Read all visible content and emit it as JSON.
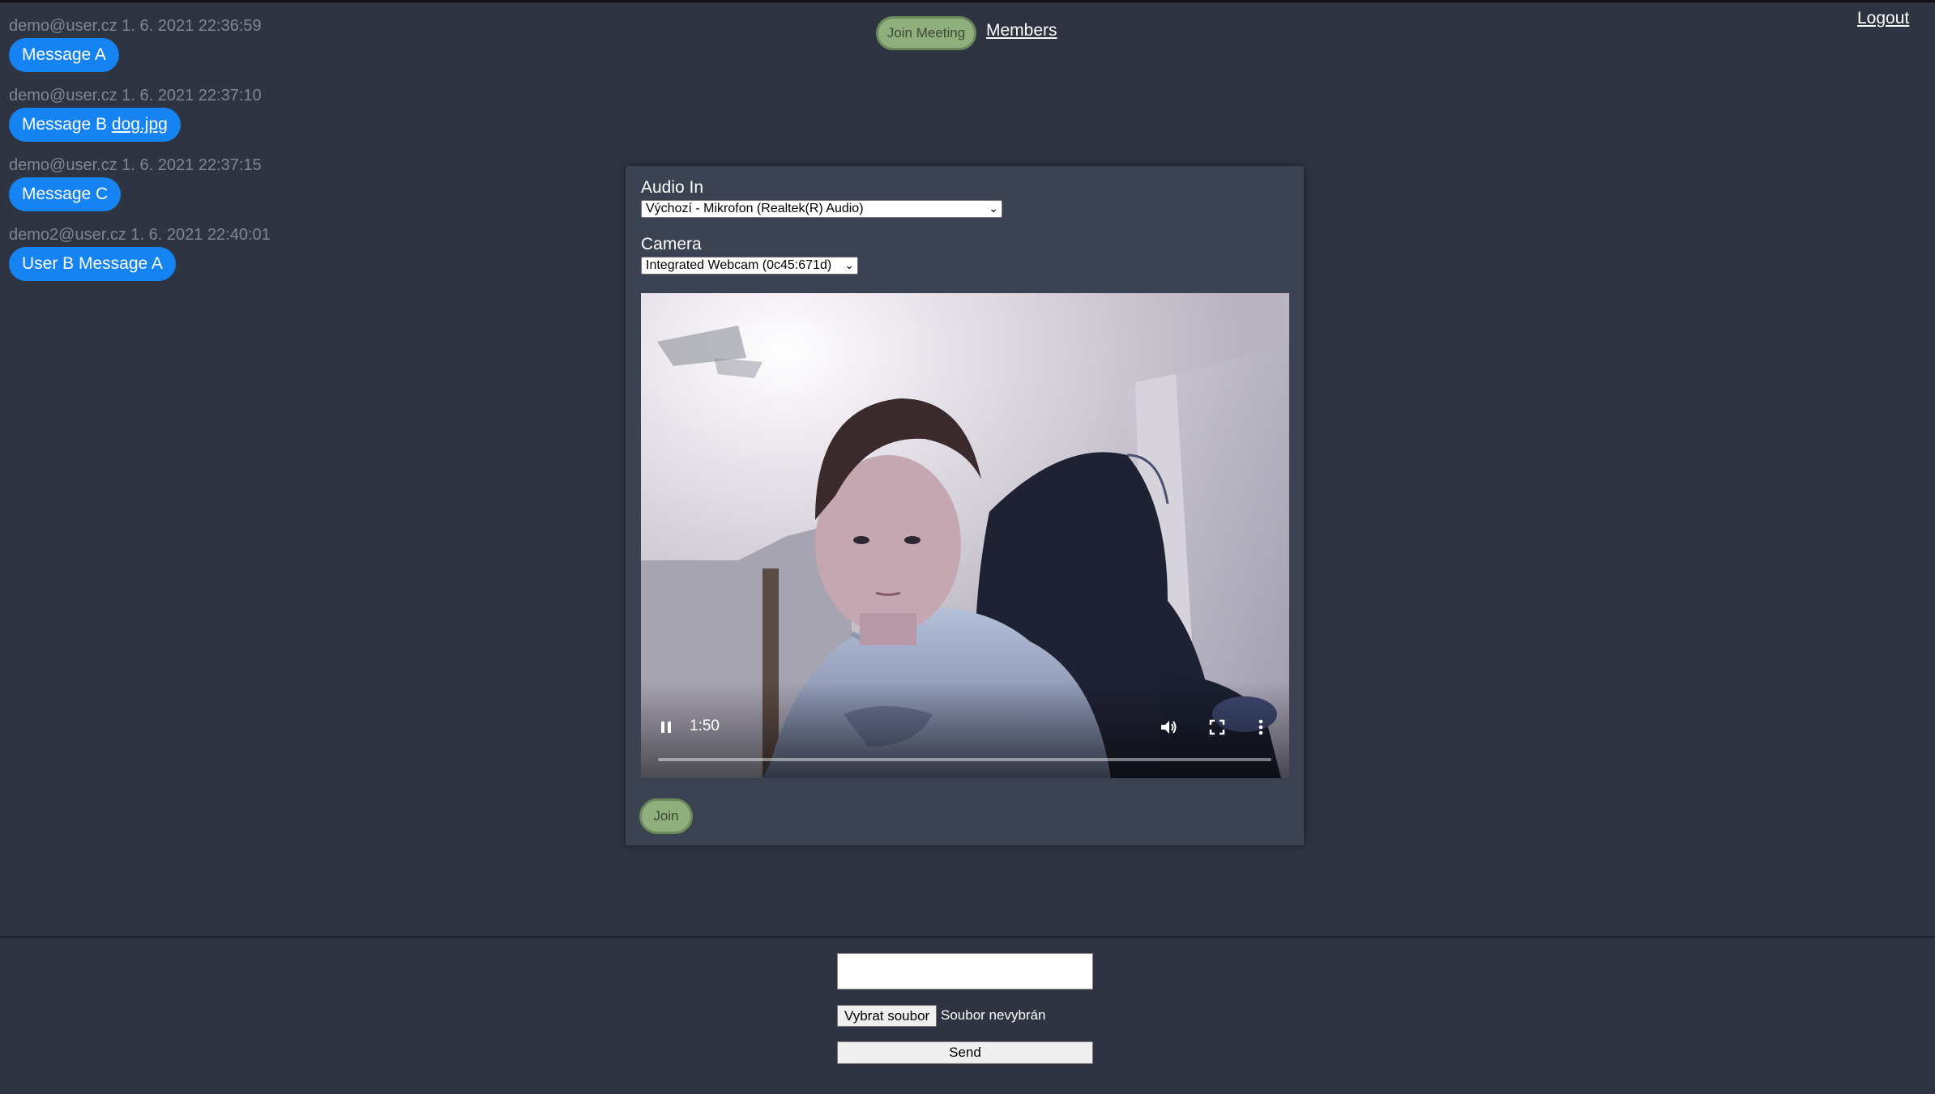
{
  "header": {
    "join_meeting_label": "Join Meeting",
    "members_label": "Members",
    "logout_label": "Logout"
  },
  "messages": [
    {
      "author": "demo@user.cz",
      "timestamp": "1. 6. 2021 22:36:59",
      "text": "Message A",
      "attachment": ""
    },
    {
      "author": "demo@user.cz",
      "timestamp": "1. 6. 2021 22:37:10",
      "text": "Message B",
      "attachment": "dog.jpg"
    },
    {
      "author": "demo@user.cz",
      "timestamp": "1. 6. 2021 22:37:15",
      "text": "Message C",
      "attachment": ""
    },
    {
      "author": "demo2@user.cz",
      "timestamp": "1. 6. 2021 22:40:01",
      "text": "User B Message A",
      "attachment": ""
    }
  ],
  "meeting_dialog": {
    "audio_label": "Audio In",
    "audio_selected": "Výchozí - Mikrofon (Realtek(R) Audio)",
    "camera_label": "Camera",
    "camera_selected": "Integrated Webcam (0c45:671d)",
    "video_time": "1:50",
    "join_label": "Join"
  },
  "composer": {
    "message_value": "",
    "file_button_label": "Vybrat soubor",
    "file_status": "Soubor nevybrán",
    "send_label": "Send"
  },
  "colors": {
    "background": "#2e3442",
    "dialog": "#3b4252",
    "bubble": "#1583f2",
    "join_button": "#8fb07c"
  },
  "icons": [
    "pause-icon",
    "volume-icon",
    "fullscreen-icon",
    "more-options-icon"
  ]
}
